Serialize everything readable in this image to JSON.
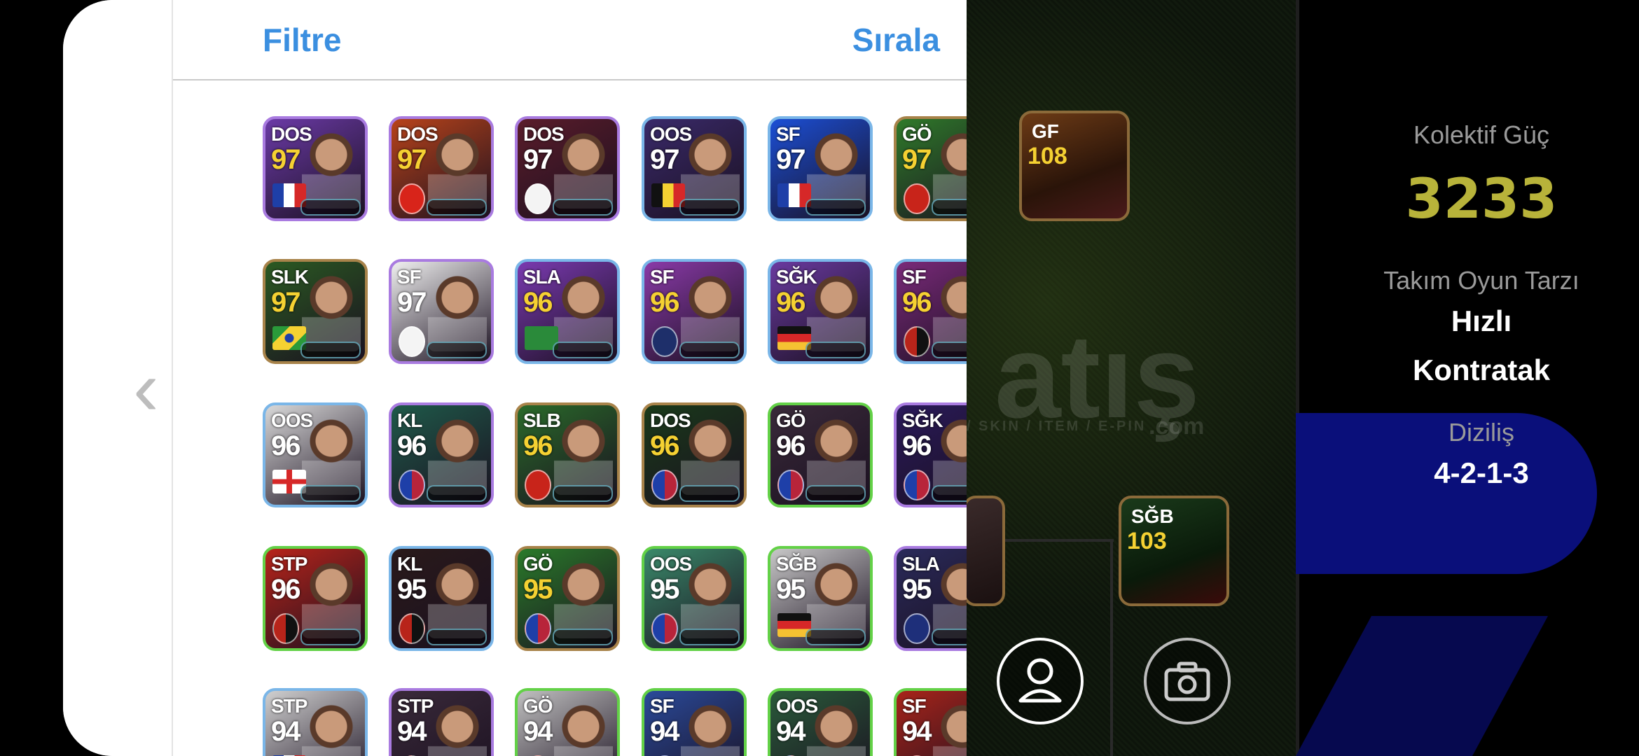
{
  "panel": {
    "filter_label": "Filtre",
    "sort_label": "Sırala",
    "back_icon": "chevron-left-icon"
  },
  "players": [
    {
      "pos": "DOS",
      "rating": "97",
      "style": "purple",
      "bg": "#6b3aa6",
      "rating_color": "#f5d132",
      "badge": "flag-france"
    },
    {
      "pos": "DOS",
      "rating": "97",
      "style": "purple",
      "bg": "#b8431a",
      "rating_color": "#f5d132",
      "badge": "crest-arsenal"
    },
    {
      "pos": "DOS",
      "rating": "97",
      "style": "purple",
      "bg": "#5a1c2a",
      "rating_color": "#ffffff",
      "badge": "crest-real-madrid"
    },
    {
      "pos": "OOS",
      "rating": "97",
      "style": "blue",
      "bg": "#3a2a6a",
      "rating_color": "#ffffff",
      "badge": "flag-belgium"
    },
    {
      "pos": "SF",
      "rating": "97",
      "style": "blue",
      "bg": "#1b4fd6",
      "rating_color": "#ffffff",
      "badge": "flag-france"
    },
    {
      "pos": "GÖ",
      "rating": "97",
      "style": "gold",
      "bg": "#2f7a2a",
      "rating_color": "#f5d132",
      "badge": "crest-man-united"
    },
    {
      "pos": "SLK",
      "rating": "97",
      "style": "gold",
      "bg": "#2b5a22",
      "rating_color": "#f5d132",
      "badge": "flag-brazil"
    },
    {
      "pos": "SF",
      "rating": "97",
      "style": "purple",
      "bg": "#f0f0f0",
      "rating_color": "#ffffff",
      "badge": "crest-real-madrid"
    },
    {
      "pos": "SLA",
      "rating": "96",
      "style": "blue",
      "bg": "#7a3ab0",
      "rating_color": "#f5d132",
      "badge": "flag-saudi-arabia"
    },
    {
      "pos": "SF",
      "rating": "96",
      "style": "blue",
      "bg": "#8a3aa8",
      "rating_color": "#f5d132",
      "badge": "crest-basaksehir"
    },
    {
      "pos": "SĞK",
      "rating": "96",
      "style": "blue",
      "bg": "#6a3aa0",
      "rating_color": "#f5d132",
      "badge": "flag-germany"
    },
    {
      "pos": "SF",
      "rating": "96",
      "style": "blue",
      "bg": "#7a2a7a",
      "rating_color": "#f5d132",
      "badge": "crest-milan"
    },
    {
      "pos": "OOS",
      "rating": "96",
      "style": "blue",
      "bg": "#d9d9d9",
      "rating_color": "#ffffff",
      "badge": "flag-england"
    },
    {
      "pos": "KL",
      "rating": "96",
      "style": "purple",
      "bg": "#1f5a4a",
      "rating_color": "#ffffff",
      "badge": "crest-barcelona"
    },
    {
      "pos": "SLB",
      "rating": "96",
      "style": "gold",
      "bg": "#2a6a2a",
      "rating_color": "#f5d132",
      "badge": "crest-man-united"
    },
    {
      "pos": "DOS",
      "rating": "96",
      "style": "gold",
      "bg": "#1a3a1a",
      "rating_color": "#f5d132",
      "badge": "crest-barcelona"
    },
    {
      "pos": "GÖ",
      "rating": "96",
      "style": "green",
      "bg": "#3a2a3a",
      "rating_color": "#ffffff",
      "badge": "crest-barcelona"
    },
    {
      "pos": "SĞK",
      "rating": "96",
      "style": "purple",
      "bg": "#2a1a5a",
      "rating_color": "#ffffff",
      "badge": "crest-barcelona"
    },
    {
      "pos": "STP",
      "rating": "96",
      "style": "green",
      "bg": "#b8241a",
      "rating_color": "#ffffff",
      "badge": "crest-milan"
    },
    {
      "pos": "KL",
      "rating": "95",
      "style": "blue",
      "bg": "#2a1a1a",
      "rating_color": "#ffffff",
      "badge": "crest-milan"
    },
    {
      "pos": "GÖ",
      "rating": "95",
      "style": "gold",
      "bg": "#2a7a2a",
      "rating_color": "#f5d132",
      "badge": "crest-barcelona"
    },
    {
      "pos": "OOS",
      "rating": "95",
      "style": "green",
      "bg": "#3a8a6a",
      "rating_color": "#ffffff",
      "badge": "crest-barcelona"
    },
    {
      "pos": "SĞB",
      "rating": "95",
      "style": "green",
      "bg": "#c8c8c8",
      "rating_color": "#ffffff",
      "badge": "flag-germany"
    },
    {
      "pos": "SLA",
      "rating": "95",
      "style": "purple",
      "bg": "#2a2a5a",
      "rating_color": "#ffffff",
      "badge": "crest-psg"
    },
    {
      "pos": "STP",
      "rating": "94",
      "style": "blue",
      "bg": "#d0d0d0",
      "rating_color": "#ffffff",
      "badge": "flag-france"
    },
    {
      "pos": "STP",
      "rating": "94",
      "style": "purple",
      "bg": "#3a2a3a",
      "rating_color": "#ffffff",
      "badge": "crest-milan"
    },
    {
      "pos": "GÖ",
      "rating": "94",
      "style": "green",
      "bg": "#c0c0c0",
      "rating_color": "#ffffff",
      "badge": "crest-man-united"
    },
    {
      "pos": "SF",
      "rating": "94",
      "style": "green",
      "bg": "#2a4a9a",
      "rating_color": "#ffffff",
      "badge": "crest-chelsea"
    },
    {
      "pos": "OOS",
      "rating": "94",
      "style": "green",
      "bg": "#2a5a3a",
      "rating_color": "#ffffff",
      "badge": "crest-barcelona"
    },
    {
      "pos": "SF",
      "rating": "94",
      "style": "green",
      "bg": "#a8241a",
      "rating_color": "#ffffff",
      "badge": "crest-liverpool"
    }
  ],
  "team_info": {
    "collective_label": "Kolektif Güç",
    "collective_value": "3233",
    "style_label": "Takım Oyun Tarzı",
    "style_value_1": "Hızlı",
    "style_value_2": "Kontratak",
    "formation_label": "Diziliş",
    "formation_value": "4-2-1-3"
  },
  "field_cards": [
    {
      "pos": "GF",
      "rating": "108"
    },
    {
      "pos": "SĞB",
      "rating": "103"
    }
  ],
  "watermark": {
    "main": "atış",
    "sub": "/ SKIN / ITEM / E-PIN",
    "com": ".com"
  },
  "buttons": {
    "profile_icon": "person-icon",
    "camera_icon": "camera-icon"
  }
}
